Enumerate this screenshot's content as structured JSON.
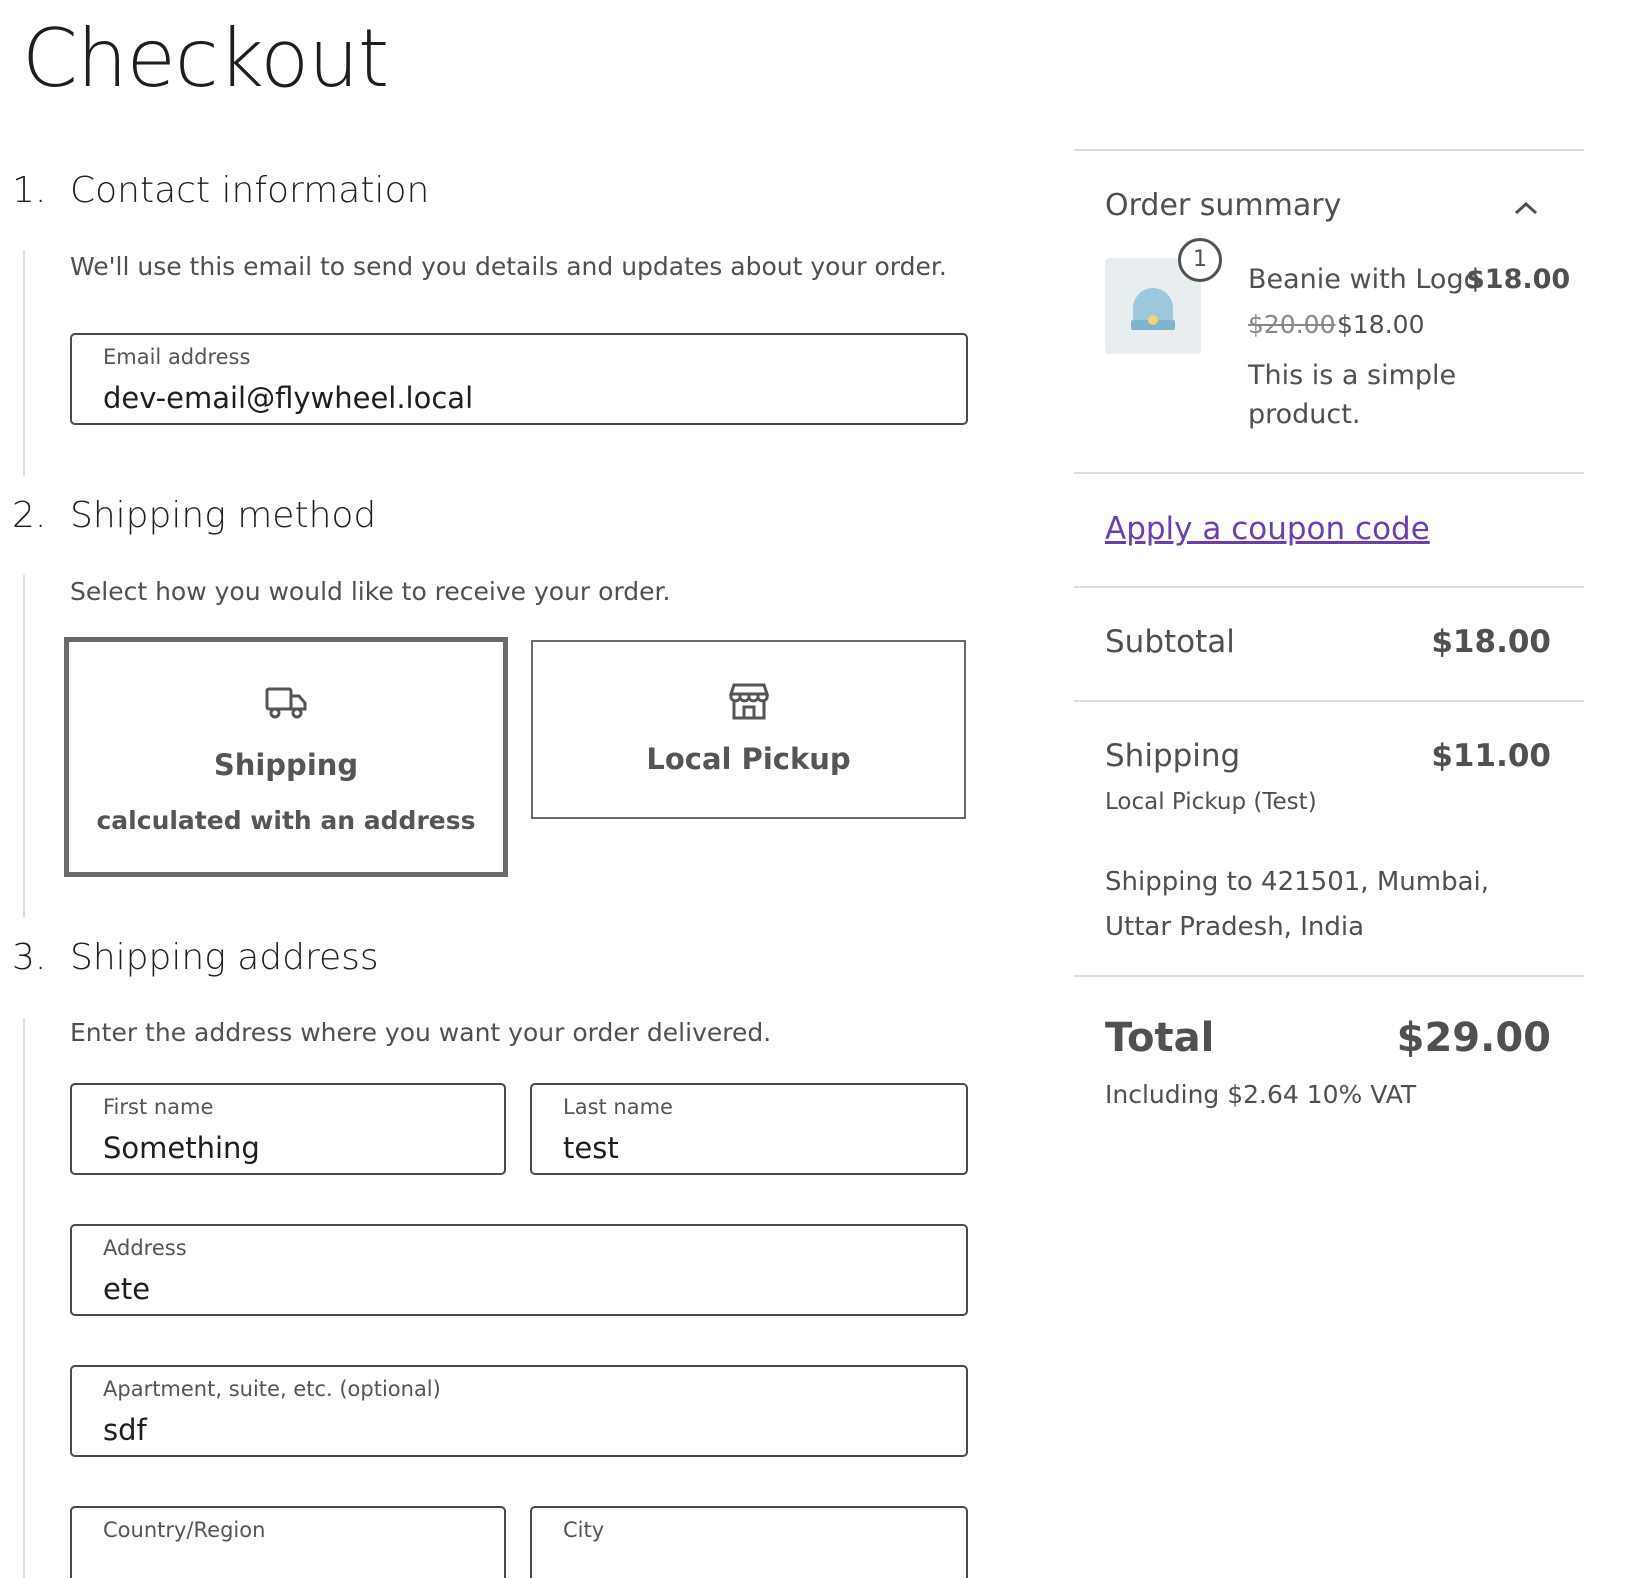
{
  "page_title": "Checkout",
  "contact": {
    "number": "1.",
    "title": "Contact information",
    "description": "We'll use this email to send you details and updates about your order.",
    "email_label": "Email address",
    "email_value": "dev-email@flywheel.local"
  },
  "shipping_method": {
    "number": "2.",
    "title": "Shipping method",
    "description": "Select how you would like to receive your order.",
    "options": [
      {
        "title": "Shipping",
        "subtitle": "calculated with an address",
        "icon": "truck-icon",
        "selected": true
      },
      {
        "title": "Local Pickup",
        "subtitle": "",
        "icon": "store-icon",
        "selected": false
      }
    ]
  },
  "shipping_address": {
    "number": "3.",
    "title": "Shipping address",
    "description": "Enter the address where you want your order delivered.",
    "first_name_label": "First name",
    "first_name_value": "Something",
    "last_name_label": "Last name",
    "last_name_value": "test",
    "address_label": "Address",
    "address_value": "ete",
    "apartment_label": "Apartment, suite, etc. (optional)",
    "apartment_value": "sdf",
    "country_label": "Country/Region",
    "city_label": "City"
  },
  "summary": {
    "title": "Order summary",
    "item": {
      "quantity": "1",
      "name": "Beanie with Logo",
      "line_price": "$18.00",
      "regular_price": "$20.00",
      "sale_price": "$18.00",
      "description": "This is a simple product."
    },
    "coupon_link": "Apply a coupon code",
    "subtotal_label": "Subtotal",
    "subtotal_value": "$18.00",
    "shipping_label": "Shipping",
    "shipping_value": "$11.00",
    "shipping_method": "Local Pickup (Test)",
    "shipping_to": "Shipping to 421501, Mumbai, Uttar Pradesh, India",
    "total_label": "Total",
    "total_value": "$29.00",
    "tax_note": "Including $2.64 10% VAT"
  },
  "colors": {
    "link": "#6b3fb0",
    "border": "#4a4a4a",
    "divider": "#dcdcdc"
  }
}
